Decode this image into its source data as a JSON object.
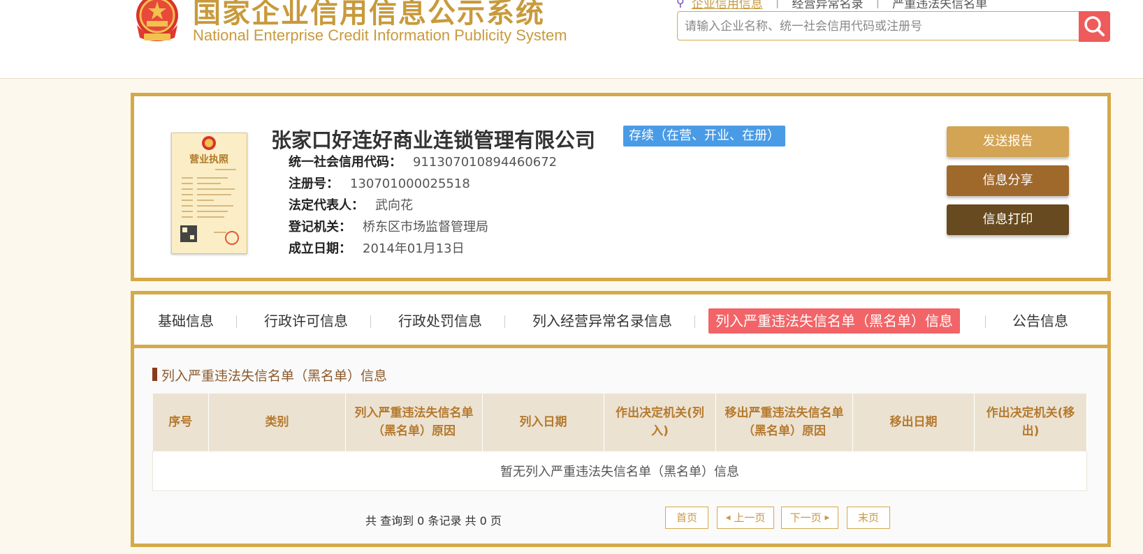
{
  "header": {
    "logo_cn": "国家企业信用信息公示系统",
    "logo_en": "National Enterprise Credit Information Publicity System",
    "links": [
      "企业信用信息",
      "经营异常名录",
      "严重违法失信名单"
    ],
    "search_placeholder": "请输入企业名称、统一社会信用代码或注册号"
  },
  "company": {
    "name": "张家口好连好商业连锁管理有限公司",
    "status": "存续（在营、开业、在册）",
    "fields": [
      {
        "label": "统一社会信用代码：",
        "value": "911307010894460672"
      },
      {
        "label": "注册号：",
        "value": "130701000025518"
      },
      {
        "label": "法定代表人：",
        "value": "武向花"
      },
      {
        "label": "登记机关：",
        "value": "桥东区市场监督管理局"
      },
      {
        "label": "成立日期：",
        "value": "2014年01月13日"
      }
    ],
    "license_title": "营业执照"
  },
  "actions": {
    "send_report": "发送报告",
    "share": "信息分享",
    "print": "信息打印"
  },
  "tabs": [
    "基础信息",
    "行政许可信息",
    "行政处罚信息",
    "列入经营异常名录信息",
    "列入严重违法失信名单（黑名单）信息",
    "公告信息"
  ],
  "section": {
    "title": "列入严重违法失信名单（黑名单）信息",
    "columns": [
      "序号",
      "类别",
      "列入严重违法失信名单（黑名单）原因",
      "列入日期",
      "作出决定机关(列入)",
      "移出严重违法失信名单（黑名单）原因",
      "移出日期",
      "作出决定机关(移出)"
    ],
    "empty_text": "暂无列入严重违法失信名单（黑名单）信息"
  },
  "pagination": {
    "summary": "共 查询到 0 条记录 共 0 页",
    "first": "首页",
    "prev": "上一页",
    "next": "下一页",
    "last": "末页"
  },
  "colors": {
    "gold": "#d4a949",
    "active_tab": "#f26467",
    "status_blue": "#4a9be6",
    "btn_report": "#d2a453",
    "btn_share": "#a0692c",
    "btn_print": "#674a1f"
  }
}
